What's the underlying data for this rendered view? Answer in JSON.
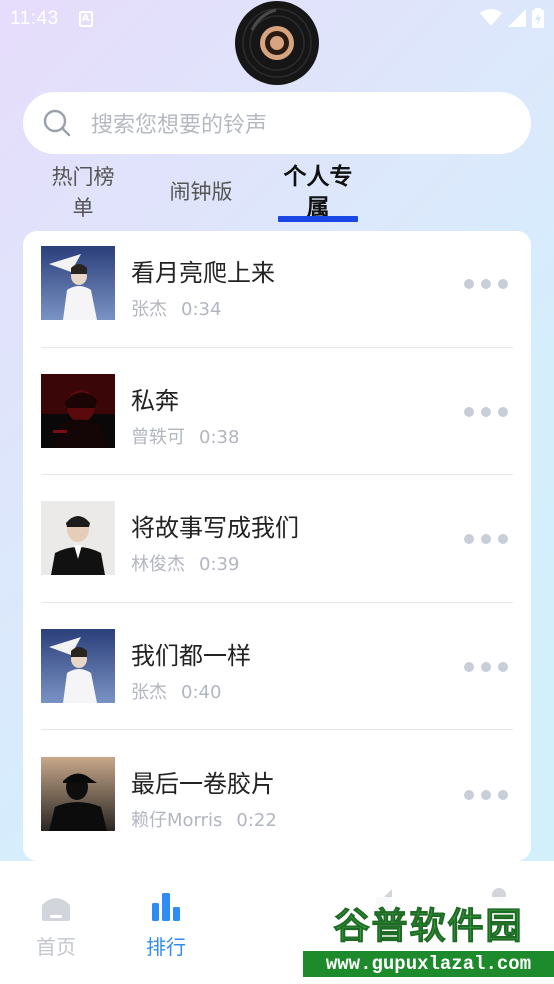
{
  "status_bar": {
    "time": "11:43",
    "a_icon": "A"
  },
  "search": {
    "placeholder": "搜索您想要的铃声",
    "icon": "search-icon"
  },
  "tabs": [
    {
      "label": "热门榜单",
      "active": false
    },
    {
      "label": "闹钟版",
      "active": false
    },
    {
      "label": "个人专属",
      "active": true
    }
  ],
  "songs": [
    {
      "title": "看月亮爬上来",
      "artist": "张杰",
      "duration": "0:34"
    },
    {
      "title": "私奔",
      "artist": "曾轶可",
      "duration": "0:38"
    },
    {
      "title": "将故事写成我们",
      "artist": "林俊杰",
      "duration": "0:39"
    },
    {
      "title": "我们都一样",
      "artist": "张杰",
      "duration": "0:40"
    },
    {
      "title": "最后一卷胶片",
      "artist": "赖仔Morris",
      "duration": "0:22"
    }
  ],
  "bottom_nav": [
    {
      "label": "首页",
      "icon": "home-icon",
      "active": false
    },
    {
      "label": "排行",
      "icon": "bar-chart-icon",
      "active": true
    }
  ],
  "watermark": {
    "title": "谷普软件园",
    "url": "www.gupuxlazal.com"
  },
  "colors": {
    "accent": "#1a47e6",
    "nav_active": "#2f8cf2",
    "nav_inactive": "#c4c7cf",
    "meta_text": "#b2b6bf"
  }
}
